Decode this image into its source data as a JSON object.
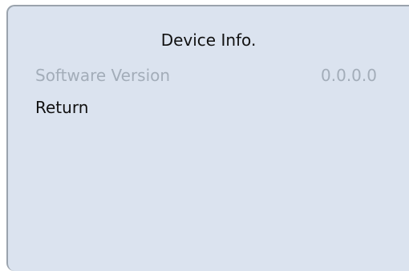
{
  "panel": {
    "title": "Device Info.",
    "items": [
      {
        "label": "Software Version",
        "value": "0.0.0.0"
      },
      {
        "label": "Return"
      }
    ]
  }
}
